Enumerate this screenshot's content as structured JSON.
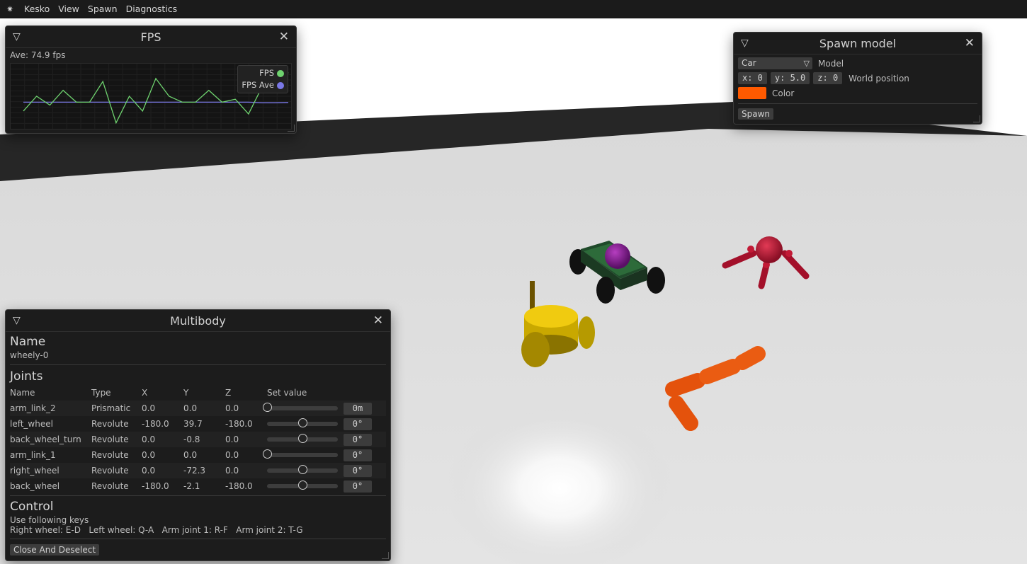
{
  "menu": {
    "logo_icon": "gear-icon",
    "items": [
      "Kesko",
      "View",
      "Spawn",
      "Diagnostics"
    ]
  },
  "fps_window": {
    "title": "FPS",
    "average": "Ave: 74.9 fps",
    "legend": [
      {
        "label": "FPS",
        "color": "#6fd36f"
      },
      {
        "label": "FPS Ave",
        "color": "#7a78e6"
      }
    ],
    "fps_series": [
      72,
      77,
      74,
      79,
      75,
      75,
      82,
      68,
      77,
      72,
      83,
      77,
      75,
      75,
      79,
      75,
      76,
      71,
      80,
      79,
      85
    ],
    "avg_series": [
      75,
      75,
      75,
      75,
      75,
      75,
      75,
      75,
      75,
      75,
      75,
      75,
      75,
      75,
      75,
      75,
      75,
      75,
      74.8,
      74.8,
      74.9
    ]
  },
  "spawn_window": {
    "title": "Spawn model",
    "model_value": "Car",
    "model_label": "Model",
    "x_field": "x: 0",
    "y_field": "y: 5.0",
    "z_field": "z: 0",
    "position_label": "World position",
    "color_value": "#ff5a00",
    "color_label": "Color",
    "spawn_button": "Spawn"
  },
  "multibody_window": {
    "title": "Multibody",
    "name_heading": "Name",
    "name_value": "wheely-0",
    "joints_heading": "Joints",
    "columns": [
      "Name",
      "Type",
      "X",
      "Y",
      "Z",
      "Set value"
    ],
    "joints": [
      {
        "name": "arm_link_2",
        "type": "Prismatic",
        "x": "0.0",
        "y": "0.0",
        "z": "0.0",
        "set": "0m",
        "slider": 0.0
      },
      {
        "name": "left_wheel",
        "type": "Revolute",
        "x": "-180.0",
        "y": "39.7",
        "z": "-180.0",
        "set": "0°",
        "slider": 0.5
      },
      {
        "name": "back_wheel_turn",
        "type": "Revolute",
        "x": "0.0",
        "y": "-0.8",
        "z": "0.0",
        "set": "0°",
        "slider": 0.5
      },
      {
        "name": "arm_link_1",
        "type": "Revolute",
        "x": "0.0",
        "y": "0.0",
        "z": "0.0",
        "set": "0°",
        "slider": 0.0
      },
      {
        "name": "right_wheel",
        "type": "Revolute",
        "x": "0.0",
        "y": "-72.3",
        "z": "0.0",
        "set": "0°",
        "slider": 0.5
      },
      {
        "name": "back_wheel",
        "type": "Revolute",
        "x": "-180.0",
        "y": "-2.1",
        "z": "-180.0",
        "set": "0°",
        "slider": 0.5
      }
    ],
    "control_heading": "Control",
    "control_intro": "Use following keys",
    "control_keys": "Right wheel: E-D   Left wheel: Q-A   Arm joint 1: R-F   Arm joint 2: T-G",
    "close_button": "Close And Deselect"
  }
}
